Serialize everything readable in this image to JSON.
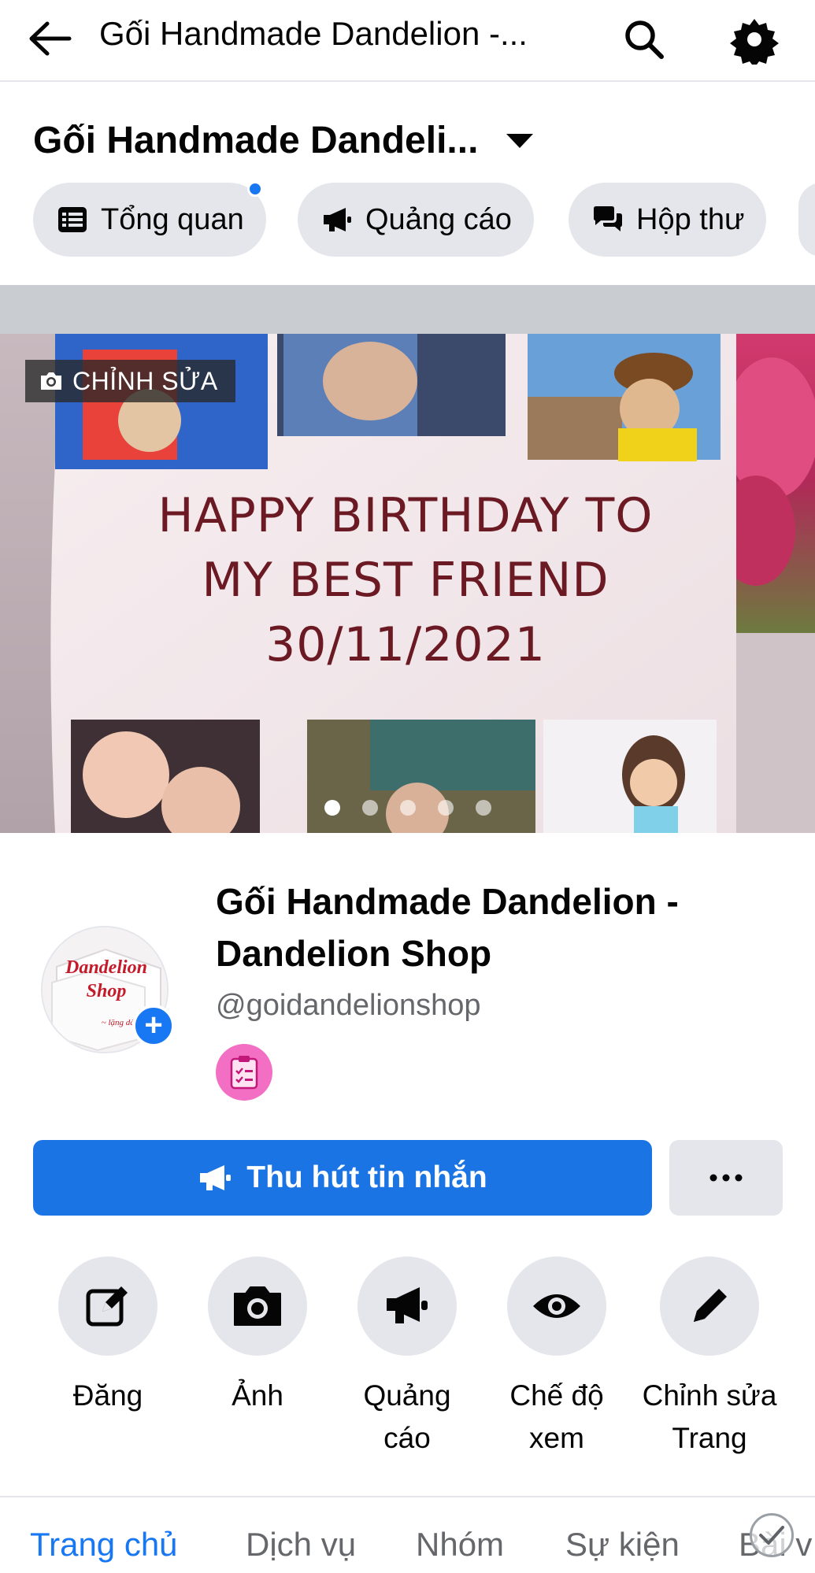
{
  "topbar": {
    "title": "Gối Handmade Dandelion -..."
  },
  "page": {
    "name": "Gối Handmade Dandeli..."
  },
  "chips": [
    {
      "label": "Tổng quan",
      "icon": "list-icon",
      "has_notification": true
    },
    {
      "label": "Quảng cáo",
      "icon": "megaphone-icon"
    },
    {
      "label": "Hộp thư",
      "icon": "chat-bubbles-icon"
    }
  ],
  "cover": {
    "edit_label": "CHỈNH SỬA",
    "slide_count": 5,
    "active_slide": 1,
    "pillow_text": [
      "HAPPY BIRTHDAY TO",
      "MY BEST FRIEND",
      "30/11/2021"
    ]
  },
  "profile": {
    "name": "Gối Handmade Dandelion - Dandelion Shop",
    "handle": "@goidandelionshop",
    "avatar_text": [
      "Dandelion",
      "Shop"
    ],
    "category_icon": "clipboard-icon"
  },
  "buttons": {
    "primary_label": "Thu hút tin nhắn",
    "more_label": "···"
  },
  "actions": [
    {
      "label": "Đăng",
      "icon": "compose-icon"
    },
    {
      "label": "Ảnh",
      "icon": "camera-icon"
    },
    {
      "label": "Quảng cáo",
      "icon": "megaphone-icon"
    },
    {
      "label": "Chế độ xem",
      "icon": "eye-icon"
    },
    {
      "label": "Chỉnh sửa Trang",
      "icon": "pencil-icon"
    }
  ],
  "tabs": [
    {
      "label": "Trang chủ",
      "active": true
    },
    {
      "label": "Dịch vụ"
    },
    {
      "label": "Nhóm"
    },
    {
      "label": "Sự kiện"
    },
    {
      "label": "Bài v"
    }
  ],
  "colors": {
    "accent": "#1877f2",
    "cta": "#1b74e4",
    "chip_bg": "#e4e6eb",
    "pillow_text": "#6b1a24"
  }
}
